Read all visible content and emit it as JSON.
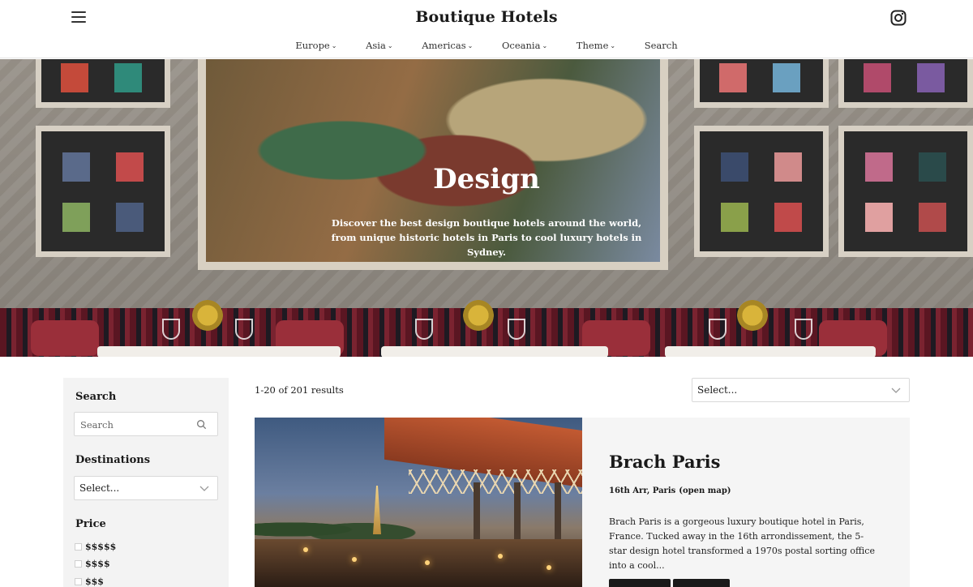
{
  "header": {
    "site_title": "Boutique Hotels",
    "nav": [
      {
        "label": "Europe",
        "has_dropdown": true
      },
      {
        "label": "Asia",
        "has_dropdown": true
      },
      {
        "label": "Americas",
        "has_dropdown": true
      },
      {
        "label": "Oceania",
        "has_dropdown": true
      },
      {
        "label": "Theme",
        "has_dropdown": true
      },
      {
        "label": "Search",
        "has_dropdown": false
      }
    ],
    "icons": {
      "menu": "hamburger-icon",
      "social": "instagram-icon"
    }
  },
  "hero": {
    "title": "Design",
    "subtitle": "Discover the best design boutique hotels around the world, from unique historic hotels in Paris to cool luxury hotels in Sydney."
  },
  "sidebar": {
    "search_heading": "Search",
    "search_placeholder": "Search",
    "destinations_heading": "Destinations",
    "destinations_value": "Select...",
    "price_heading": "Price",
    "price_options": [
      "$$$$$",
      "$$$$",
      "$$$"
    ]
  },
  "results": {
    "count_text": "1-20 of 201 results",
    "sort_value": "Select..."
  },
  "card": {
    "name": "Brach Paris",
    "location": "16th Arr, Paris",
    "map_link": "(open map)",
    "description": "Brach Paris is a gorgeous luxury boutique hotel in Paris, France. Tucked away in the 16th arrondissement, the 5-star design hotel transformed a 1970s postal sorting office into a cool..."
  },
  "colors": {
    "accent": "#1a1a1a",
    "sidebar_bg": "#f3f3f3",
    "card_bg": "#f5f5f5"
  }
}
